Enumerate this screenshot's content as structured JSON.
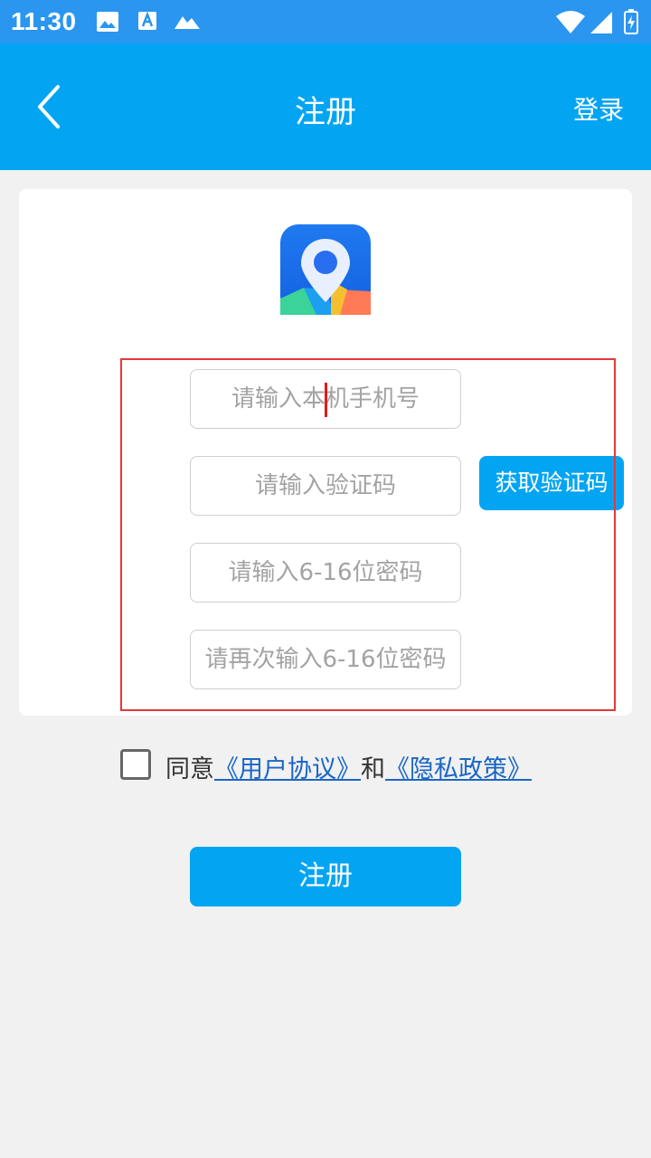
{
  "status_bar": {
    "time": "11:30",
    "icons": [
      "image-icon",
      "a11y-font-icon",
      "mountain-icon",
      "wifi-icon",
      "signal-icon",
      "battery-charging-icon"
    ]
  },
  "app_bar": {
    "title": "注册",
    "login_label": "登录",
    "back_icon": "chevron-left-icon"
  },
  "form": {
    "phone_placeholder": "请输入本机手机号",
    "code_placeholder": "请输入验证码",
    "get_code_label": "获取验证码",
    "password_placeholder": "请输入6-16位密码",
    "confirm_password_placeholder": "请再次输入6-16位密码"
  },
  "agreement": {
    "checked": false,
    "prefix": "同意",
    "user_agreement": "《用户协议》",
    "and": "和",
    "privacy_policy": "《隐私政策》"
  },
  "register_button": "注册",
  "colors": {
    "primary": "#03a5f3",
    "status_bar": "#2a96f0",
    "highlight": "#e5393b",
    "link": "#1a66c7"
  }
}
